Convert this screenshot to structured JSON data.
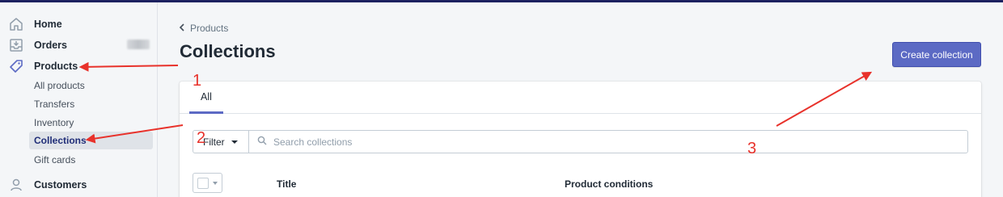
{
  "sidebar": {
    "home": "Home",
    "orders": "Orders",
    "products": "Products",
    "sub_items": [
      "All products",
      "Transfers",
      "Inventory",
      "Collections",
      "Gift cards"
    ],
    "customers": "Customers"
  },
  "breadcrumb": {
    "label": "Products"
  },
  "page": {
    "title": "Collections"
  },
  "actions": {
    "create_label": "Create collection"
  },
  "tabs": {
    "all": "All"
  },
  "filter": {
    "label": "Filter"
  },
  "search": {
    "placeholder": "Search collections",
    "value": ""
  },
  "table": {
    "columns": [
      "Title",
      "Product conditions"
    ]
  },
  "annotations": {
    "n1": "1",
    "n2": "2",
    "n3": "3"
  },
  "colors": {
    "accent": "#5c6ac4",
    "annotation": "#e8322b",
    "topbar": "#1c2260"
  }
}
